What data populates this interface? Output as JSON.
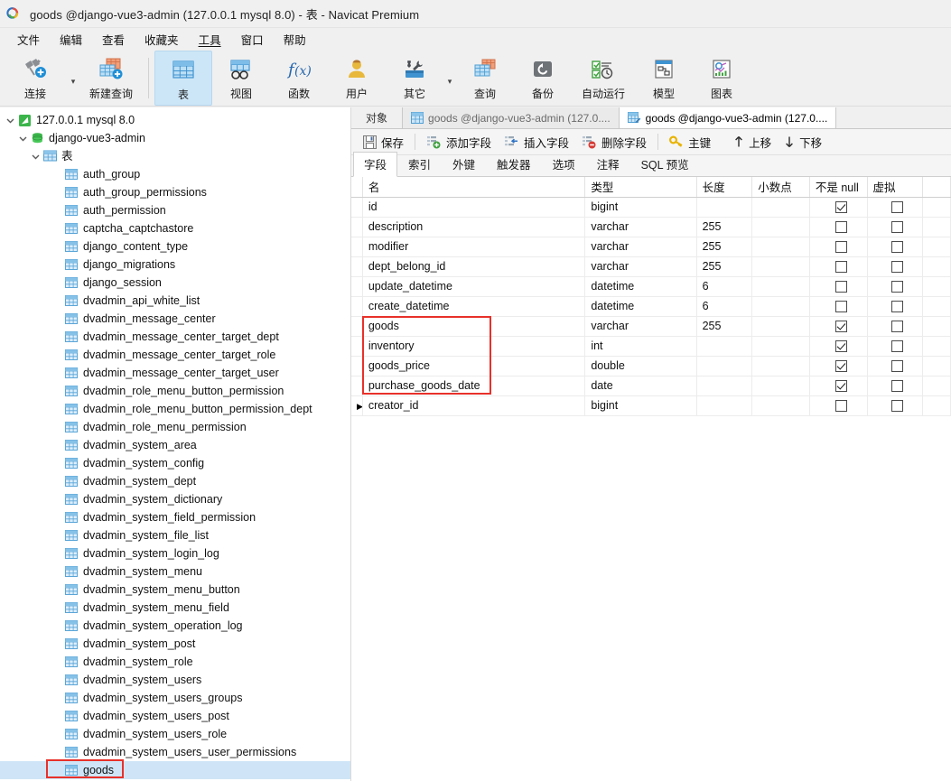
{
  "window": {
    "title": "goods @django-vue3-admin (127.0.0.1 mysql 8.0) - 表 - Navicat Premium",
    "logo_icon": "navicat-logo-icon"
  },
  "menubar": {
    "items": [
      {
        "label": "文件",
        "name": "menu-file"
      },
      {
        "label": "编辑",
        "name": "menu-edit"
      },
      {
        "label": "查看",
        "name": "menu-view"
      },
      {
        "label": "收藏夹",
        "name": "menu-favorites"
      },
      {
        "label": "工具",
        "name": "menu-tools"
      },
      {
        "label": "窗口",
        "name": "menu-window"
      },
      {
        "label": "帮助",
        "name": "menu-help"
      }
    ]
  },
  "toolbar": {
    "buttons": [
      {
        "label": "连接",
        "name": "toolbar-connection",
        "icon": "plug-plus-icon",
        "active": false,
        "caret": true
      },
      {
        "label": "新建查询",
        "name": "toolbar-new-query",
        "icon": "table-plus-icon",
        "active": false,
        "caret": false
      },
      {
        "label": "表",
        "name": "toolbar-table",
        "icon": "table-icon",
        "active": true,
        "caret": false
      },
      {
        "label": "视图",
        "name": "toolbar-view",
        "icon": "view-icon",
        "active": false,
        "caret": false
      },
      {
        "label": "函数",
        "name": "toolbar-function",
        "icon": "fx-icon",
        "active": false,
        "caret": false
      },
      {
        "label": "用户",
        "name": "toolbar-user",
        "icon": "user-icon",
        "active": false,
        "caret": false
      },
      {
        "label": "其它",
        "name": "toolbar-other",
        "icon": "tools-icon",
        "active": false,
        "caret": true
      },
      {
        "label": "查询",
        "name": "toolbar-query",
        "icon": "query-icon",
        "active": false,
        "caret": false
      },
      {
        "label": "备份",
        "name": "toolbar-backup",
        "icon": "backup-icon",
        "active": false,
        "caret": false
      },
      {
        "label": "自动运行",
        "name": "toolbar-automation",
        "icon": "automation-icon",
        "active": false,
        "caret": false
      },
      {
        "label": "模型",
        "name": "toolbar-model",
        "icon": "model-icon",
        "active": false,
        "caret": false
      },
      {
        "label": "图表",
        "name": "toolbar-chart",
        "icon": "chart-icon",
        "active": false,
        "caret": false
      }
    ]
  },
  "sidebar": {
    "nodes": [
      {
        "label": "127.0.0.1 mysql 8.0",
        "level": 0,
        "icon": "connection-icon",
        "expander": "expanded",
        "selected": false
      },
      {
        "label": "django-vue3-admin",
        "level": 1,
        "icon": "database-icon",
        "expander": "expanded",
        "selected": false
      },
      {
        "label": "表",
        "level": 2,
        "icon": "table-folder-icon",
        "expander": "expanded",
        "selected": false
      },
      {
        "label": "auth_group",
        "level": 3,
        "icon": "table-icon",
        "expander": "none",
        "selected": false
      },
      {
        "label": "auth_group_permissions",
        "level": 3,
        "icon": "table-icon",
        "expander": "none",
        "selected": false
      },
      {
        "label": "auth_permission",
        "level": 3,
        "icon": "table-icon",
        "expander": "none",
        "selected": false
      },
      {
        "label": "captcha_captchastore",
        "level": 3,
        "icon": "table-icon",
        "expander": "none",
        "selected": false
      },
      {
        "label": "django_content_type",
        "level": 3,
        "icon": "table-icon",
        "expander": "none",
        "selected": false
      },
      {
        "label": "django_migrations",
        "level": 3,
        "icon": "table-icon",
        "expander": "none",
        "selected": false
      },
      {
        "label": "django_session",
        "level": 3,
        "icon": "table-icon",
        "expander": "none",
        "selected": false
      },
      {
        "label": "dvadmin_api_white_list",
        "level": 3,
        "icon": "table-icon",
        "expander": "none",
        "selected": false
      },
      {
        "label": "dvadmin_message_center",
        "level": 3,
        "icon": "table-icon",
        "expander": "none",
        "selected": false
      },
      {
        "label": "dvadmin_message_center_target_dept",
        "level": 3,
        "icon": "table-icon",
        "expander": "none",
        "selected": false
      },
      {
        "label": "dvadmin_message_center_target_role",
        "level": 3,
        "icon": "table-icon",
        "expander": "none",
        "selected": false
      },
      {
        "label": "dvadmin_message_center_target_user",
        "level": 3,
        "icon": "table-icon",
        "expander": "none",
        "selected": false
      },
      {
        "label": "dvadmin_role_menu_button_permission",
        "level": 3,
        "icon": "table-icon",
        "expander": "none",
        "selected": false
      },
      {
        "label": "dvadmin_role_menu_button_permission_dept",
        "level": 3,
        "icon": "table-icon",
        "expander": "none",
        "selected": false
      },
      {
        "label": "dvadmin_role_menu_permission",
        "level": 3,
        "icon": "table-icon",
        "expander": "none",
        "selected": false
      },
      {
        "label": "dvadmin_system_area",
        "level": 3,
        "icon": "table-icon",
        "expander": "none",
        "selected": false
      },
      {
        "label": "dvadmin_system_config",
        "level": 3,
        "icon": "table-icon",
        "expander": "none",
        "selected": false
      },
      {
        "label": "dvadmin_system_dept",
        "level": 3,
        "icon": "table-icon",
        "expander": "none",
        "selected": false
      },
      {
        "label": "dvadmin_system_dictionary",
        "level": 3,
        "icon": "table-icon",
        "expander": "none",
        "selected": false
      },
      {
        "label": "dvadmin_system_field_permission",
        "level": 3,
        "icon": "table-icon",
        "expander": "none",
        "selected": false
      },
      {
        "label": "dvadmin_system_file_list",
        "level": 3,
        "icon": "table-icon",
        "expander": "none",
        "selected": false
      },
      {
        "label": "dvadmin_system_login_log",
        "level": 3,
        "icon": "table-icon",
        "expander": "none",
        "selected": false
      },
      {
        "label": "dvadmin_system_menu",
        "level": 3,
        "icon": "table-icon",
        "expander": "none",
        "selected": false
      },
      {
        "label": "dvadmin_system_menu_button",
        "level": 3,
        "icon": "table-icon",
        "expander": "none",
        "selected": false
      },
      {
        "label": "dvadmin_system_menu_field",
        "level": 3,
        "icon": "table-icon",
        "expander": "none",
        "selected": false
      },
      {
        "label": "dvadmin_system_operation_log",
        "level": 3,
        "icon": "table-icon",
        "expander": "none",
        "selected": false
      },
      {
        "label": "dvadmin_system_post",
        "level": 3,
        "icon": "table-icon",
        "expander": "none",
        "selected": false
      },
      {
        "label": "dvadmin_system_role",
        "level": 3,
        "icon": "table-icon",
        "expander": "none",
        "selected": false
      },
      {
        "label": "dvadmin_system_users",
        "level": 3,
        "icon": "table-icon",
        "expander": "none",
        "selected": false
      },
      {
        "label": "dvadmin_system_users_groups",
        "level": 3,
        "icon": "table-icon",
        "expander": "none",
        "selected": false
      },
      {
        "label": "dvadmin_system_users_post",
        "level": 3,
        "icon": "table-icon",
        "expander": "none",
        "selected": false
      },
      {
        "label": "dvadmin_system_users_role",
        "level": 3,
        "icon": "table-icon",
        "expander": "none",
        "selected": false
      },
      {
        "label": "dvadmin_system_users_user_permissions",
        "level": 3,
        "icon": "table-icon",
        "expander": "none",
        "selected": false
      },
      {
        "label": "goods",
        "level": 3,
        "icon": "table-icon",
        "expander": "none",
        "selected": true
      }
    ]
  },
  "tabs": [
    {
      "label": "对象",
      "name": "tab-objects",
      "icon": "none",
      "active": false
    },
    {
      "label": "goods @django-vue3-admin (127.0....",
      "name": "tab-goods-data",
      "icon": "table-icon",
      "active": false
    },
    {
      "label": "goods @django-vue3-admin (127.0....",
      "name": "tab-goods-design",
      "icon": "table-design-icon",
      "active": true
    }
  ],
  "actions": [
    {
      "label": "保存",
      "name": "save-button",
      "icon": "save-icon"
    },
    {
      "label": "添加字段",
      "name": "add-field-button",
      "icon": "add-field-icon"
    },
    {
      "label": "插入字段",
      "name": "insert-field-button",
      "icon": "insert-field-icon"
    },
    {
      "label": "删除字段",
      "name": "delete-field-button",
      "icon": "delete-field-icon"
    },
    {
      "label": "主键",
      "name": "primary-key-button",
      "icon": "key-icon"
    },
    {
      "label": "上移",
      "name": "move-up-button",
      "icon": "arrow-up-icon"
    },
    {
      "label": "下移",
      "name": "move-down-button",
      "icon": "arrow-down-icon"
    }
  ],
  "subtabs": [
    {
      "label": "字段",
      "name": "subtab-fields",
      "active": true
    },
    {
      "label": "索引",
      "name": "subtab-indexes",
      "active": false
    },
    {
      "label": "外键",
      "name": "subtab-foreign-keys",
      "active": false
    },
    {
      "label": "触发器",
      "name": "subtab-triggers",
      "active": false
    },
    {
      "label": "选项",
      "name": "subtab-options",
      "active": false
    },
    {
      "label": "注释",
      "name": "subtab-comment",
      "active": false
    },
    {
      "label": "SQL 预览",
      "name": "subtab-sql-preview",
      "active": false
    }
  ],
  "grid": {
    "columns": [
      {
        "label": "",
        "key": "indicator"
      },
      {
        "label": "名",
        "key": "name"
      },
      {
        "label": "类型",
        "key": "type"
      },
      {
        "label": "长度",
        "key": "length"
      },
      {
        "label": "小数点",
        "key": "decimals"
      },
      {
        "label": "不是 null",
        "key": "not_null"
      },
      {
        "label": "虚拟",
        "key": "virtual"
      },
      {
        "label": "",
        "key": "key_partial"
      }
    ],
    "rows": [
      {
        "current": false,
        "name": "id",
        "type": "bigint",
        "length": "",
        "decimals": "",
        "not_null": true,
        "virtual": false
      },
      {
        "current": false,
        "name": "description",
        "type": "varchar",
        "length": "255",
        "decimals": "",
        "not_null": false,
        "virtual": false
      },
      {
        "current": false,
        "name": "modifier",
        "type": "varchar",
        "length": "255",
        "decimals": "",
        "not_null": false,
        "virtual": false
      },
      {
        "current": false,
        "name": "dept_belong_id",
        "type": "varchar",
        "length": "255",
        "decimals": "",
        "not_null": false,
        "virtual": false
      },
      {
        "current": false,
        "name": "update_datetime",
        "type": "datetime",
        "length": "6",
        "decimals": "",
        "not_null": false,
        "virtual": false
      },
      {
        "current": false,
        "name": "create_datetime",
        "type": "datetime",
        "length": "6",
        "decimals": "",
        "not_null": false,
        "virtual": false
      },
      {
        "current": false,
        "name": "goods",
        "type": "varchar",
        "length": "255",
        "decimals": "",
        "not_null": true,
        "virtual": false
      },
      {
        "current": false,
        "name": "inventory",
        "type": "int",
        "length": "",
        "decimals": "",
        "not_null": true,
        "virtual": false
      },
      {
        "current": false,
        "name": "goods_price",
        "type": "double",
        "length": "",
        "decimals": "",
        "not_null": true,
        "virtual": false
      },
      {
        "current": false,
        "name": "purchase_goods_date",
        "type": "date",
        "length": "",
        "decimals": "",
        "not_null": true,
        "virtual": false
      },
      {
        "current": true,
        "name": "creator_id",
        "type": "bigint",
        "length": "",
        "decimals": "",
        "not_null": false,
        "virtual": false
      }
    ]
  },
  "annotations": {
    "color": "#e8312a",
    "boxes": [
      {
        "name": "annotation-goods-fields",
        "target": "grid rows goods..purchase_goods_date name column"
      },
      {
        "name": "annotation-goods-table",
        "target": "sidebar node goods"
      }
    ]
  }
}
